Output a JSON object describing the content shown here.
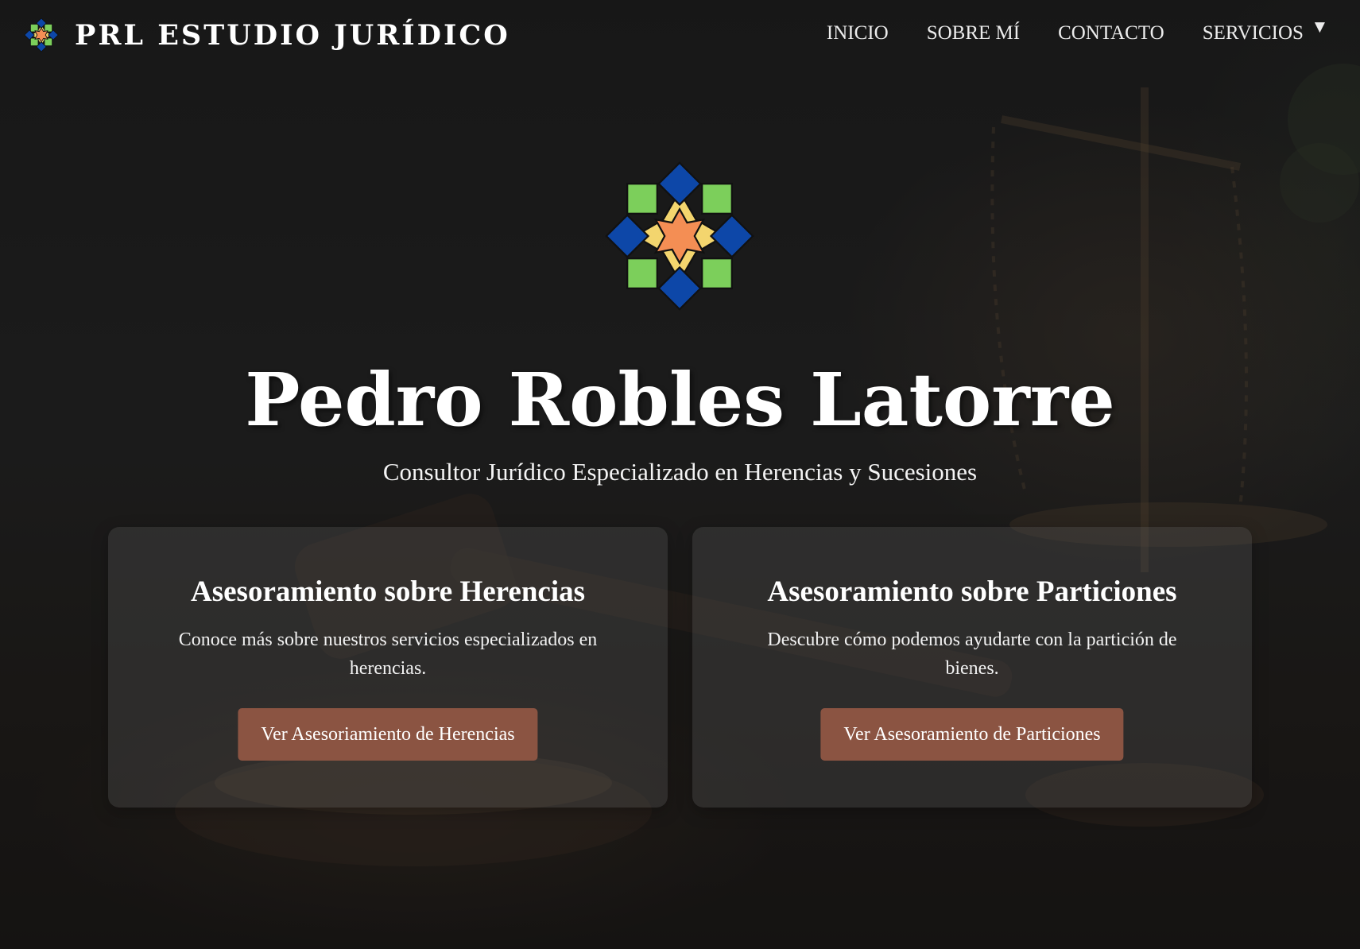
{
  "navbar": {
    "brand_name": "PRL ESTUDIO JURÍDICO",
    "brand_logo_icon": "star-tile-logo-icon",
    "items": [
      {
        "label": "INICIO"
      },
      {
        "label": "SOBRE MÍ"
      },
      {
        "label": "CONTACTO"
      },
      {
        "label": "SERVICIOS",
        "icon": "chevron-down-icon"
      }
    ]
  },
  "hero": {
    "logo_icon": "star-tile-logo-icon",
    "title": "Pedro Robles Latorre",
    "subtitle": "Consultor Jurídico Especializado en Herencias y Sucesiones"
  },
  "cards": [
    {
      "title": "Asesoramiento sobre Herencias",
      "text": "Conoce más sobre nuestros servicios especializados en herencias.",
      "button_label": "Ver Asesoriamiento de Herencias"
    },
    {
      "title": "Asesoramiento sobre Particiones",
      "text": "Descubre cómo podemos ayudarte con la partición de bienes.",
      "button_label": "Ver Asesoramiento de Particiones"
    }
  ],
  "colors": {
    "button": "#8b5442",
    "logo_blue": "#0d47a8",
    "logo_green": "#7ccf5b",
    "logo_yellow": "#f3d56e",
    "logo_orange": "#f48e54"
  }
}
